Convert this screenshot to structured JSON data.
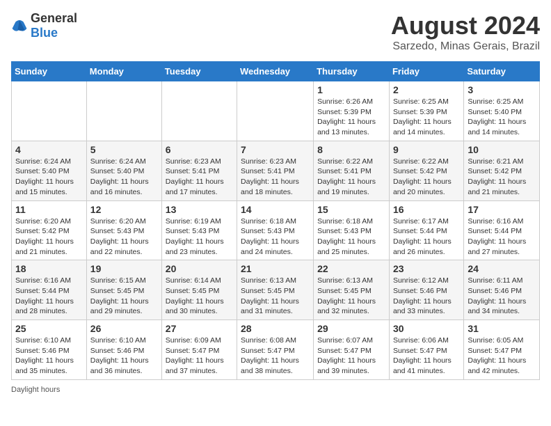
{
  "header": {
    "logo_general": "General",
    "logo_blue": "Blue",
    "month_title": "August 2024",
    "location": "Sarzedo, Minas Gerais, Brazil"
  },
  "days_of_week": [
    "Sunday",
    "Monday",
    "Tuesday",
    "Wednesday",
    "Thursday",
    "Friday",
    "Saturday"
  ],
  "weeks": [
    [
      {
        "day": "",
        "info": ""
      },
      {
        "day": "",
        "info": ""
      },
      {
        "day": "",
        "info": ""
      },
      {
        "day": "",
        "info": ""
      },
      {
        "day": "1",
        "info": "Sunrise: 6:26 AM\nSunset: 5:39 PM\nDaylight: 11 hours and 13 minutes."
      },
      {
        "day": "2",
        "info": "Sunrise: 6:25 AM\nSunset: 5:39 PM\nDaylight: 11 hours and 14 minutes."
      },
      {
        "day": "3",
        "info": "Sunrise: 6:25 AM\nSunset: 5:40 PM\nDaylight: 11 hours and 14 minutes."
      }
    ],
    [
      {
        "day": "4",
        "info": "Sunrise: 6:24 AM\nSunset: 5:40 PM\nDaylight: 11 hours and 15 minutes."
      },
      {
        "day": "5",
        "info": "Sunrise: 6:24 AM\nSunset: 5:40 PM\nDaylight: 11 hours and 16 minutes."
      },
      {
        "day": "6",
        "info": "Sunrise: 6:23 AM\nSunset: 5:41 PM\nDaylight: 11 hours and 17 minutes."
      },
      {
        "day": "7",
        "info": "Sunrise: 6:23 AM\nSunset: 5:41 PM\nDaylight: 11 hours and 18 minutes."
      },
      {
        "day": "8",
        "info": "Sunrise: 6:22 AM\nSunset: 5:41 PM\nDaylight: 11 hours and 19 minutes."
      },
      {
        "day": "9",
        "info": "Sunrise: 6:22 AM\nSunset: 5:42 PM\nDaylight: 11 hours and 20 minutes."
      },
      {
        "day": "10",
        "info": "Sunrise: 6:21 AM\nSunset: 5:42 PM\nDaylight: 11 hours and 21 minutes."
      }
    ],
    [
      {
        "day": "11",
        "info": "Sunrise: 6:20 AM\nSunset: 5:42 PM\nDaylight: 11 hours and 21 minutes."
      },
      {
        "day": "12",
        "info": "Sunrise: 6:20 AM\nSunset: 5:43 PM\nDaylight: 11 hours and 22 minutes."
      },
      {
        "day": "13",
        "info": "Sunrise: 6:19 AM\nSunset: 5:43 PM\nDaylight: 11 hours and 23 minutes."
      },
      {
        "day": "14",
        "info": "Sunrise: 6:18 AM\nSunset: 5:43 PM\nDaylight: 11 hours and 24 minutes."
      },
      {
        "day": "15",
        "info": "Sunrise: 6:18 AM\nSunset: 5:43 PM\nDaylight: 11 hours and 25 minutes."
      },
      {
        "day": "16",
        "info": "Sunrise: 6:17 AM\nSunset: 5:44 PM\nDaylight: 11 hours and 26 minutes."
      },
      {
        "day": "17",
        "info": "Sunrise: 6:16 AM\nSunset: 5:44 PM\nDaylight: 11 hours and 27 minutes."
      }
    ],
    [
      {
        "day": "18",
        "info": "Sunrise: 6:16 AM\nSunset: 5:44 PM\nDaylight: 11 hours and 28 minutes."
      },
      {
        "day": "19",
        "info": "Sunrise: 6:15 AM\nSunset: 5:45 PM\nDaylight: 11 hours and 29 minutes."
      },
      {
        "day": "20",
        "info": "Sunrise: 6:14 AM\nSunset: 5:45 PM\nDaylight: 11 hours and 30 minutes."
      },
      {
        "day": "21",
        "info": "Sunrise: 6:13 AM\nSunset: 5:45 PM\nDaylight: 11 hours and 31 minutes."
      },
      {
        "day": "22",
        "info": "Sunrise: 6:13 AM\nSunset: 5:45 PM\nDaylight: 11 hours and 32 minutes."
      },
      {
        "day": "23",
        "info": "Sunrise: 6:12 AM\nSunset: 5:46 PM\nDaylight: 11 hours and 33 minutes."
      },
      {
        "day": "24",
        "info": "Sunrise: 6:11 AM\nSunset: 5:46 PM\nDaylight: 11 hours and 34 minutes."
      }
    ],
    [
      {
        "day": "25",
        "info": "Sunrise: 6:10 AM\nSunset: 5:46 PM\nDaylight: 11 hours and 35 minutes."
      },
      {
        "day": "26",
        "info": "Sunrise: 6:10 AM\nSunset: 5:46 PM\nDaylight: 11 hours and 36 minutes."
      },
      {
        "day": "27",
        "info": "Sunrise: 6:09 AM\nSunset: 5:47 PM\nDaylight: 11 hours and 37 minutes."
      },
      {
        "day": "28",
        "info": "Sunrise: 6:08 AM\nSunset: 5:47 PM\nDaylight: 11 hours and 38 minutes."
      },
      {
        "day": "29",
        "info": "Sunrise: 6:07 AM\nSunset: 5:47 PM\nDaylight: 11 hours and 39 minutes."
      },
      {
        "day": "30",
        "info": "Sunrise: 6:06 AM\nSunset: 5:47 PM\nDaylight: 11 hours and 41 minutes."
      },
      {
        "day": "31",
        "info": "Sunrise: 6:05 AM\nSunset: 5:47 PM\nDaylight: 11 hours and 42 minutes."
      }
    ]
  ],
  "footer": {
    "note": "Daylight hours"
  }
}
